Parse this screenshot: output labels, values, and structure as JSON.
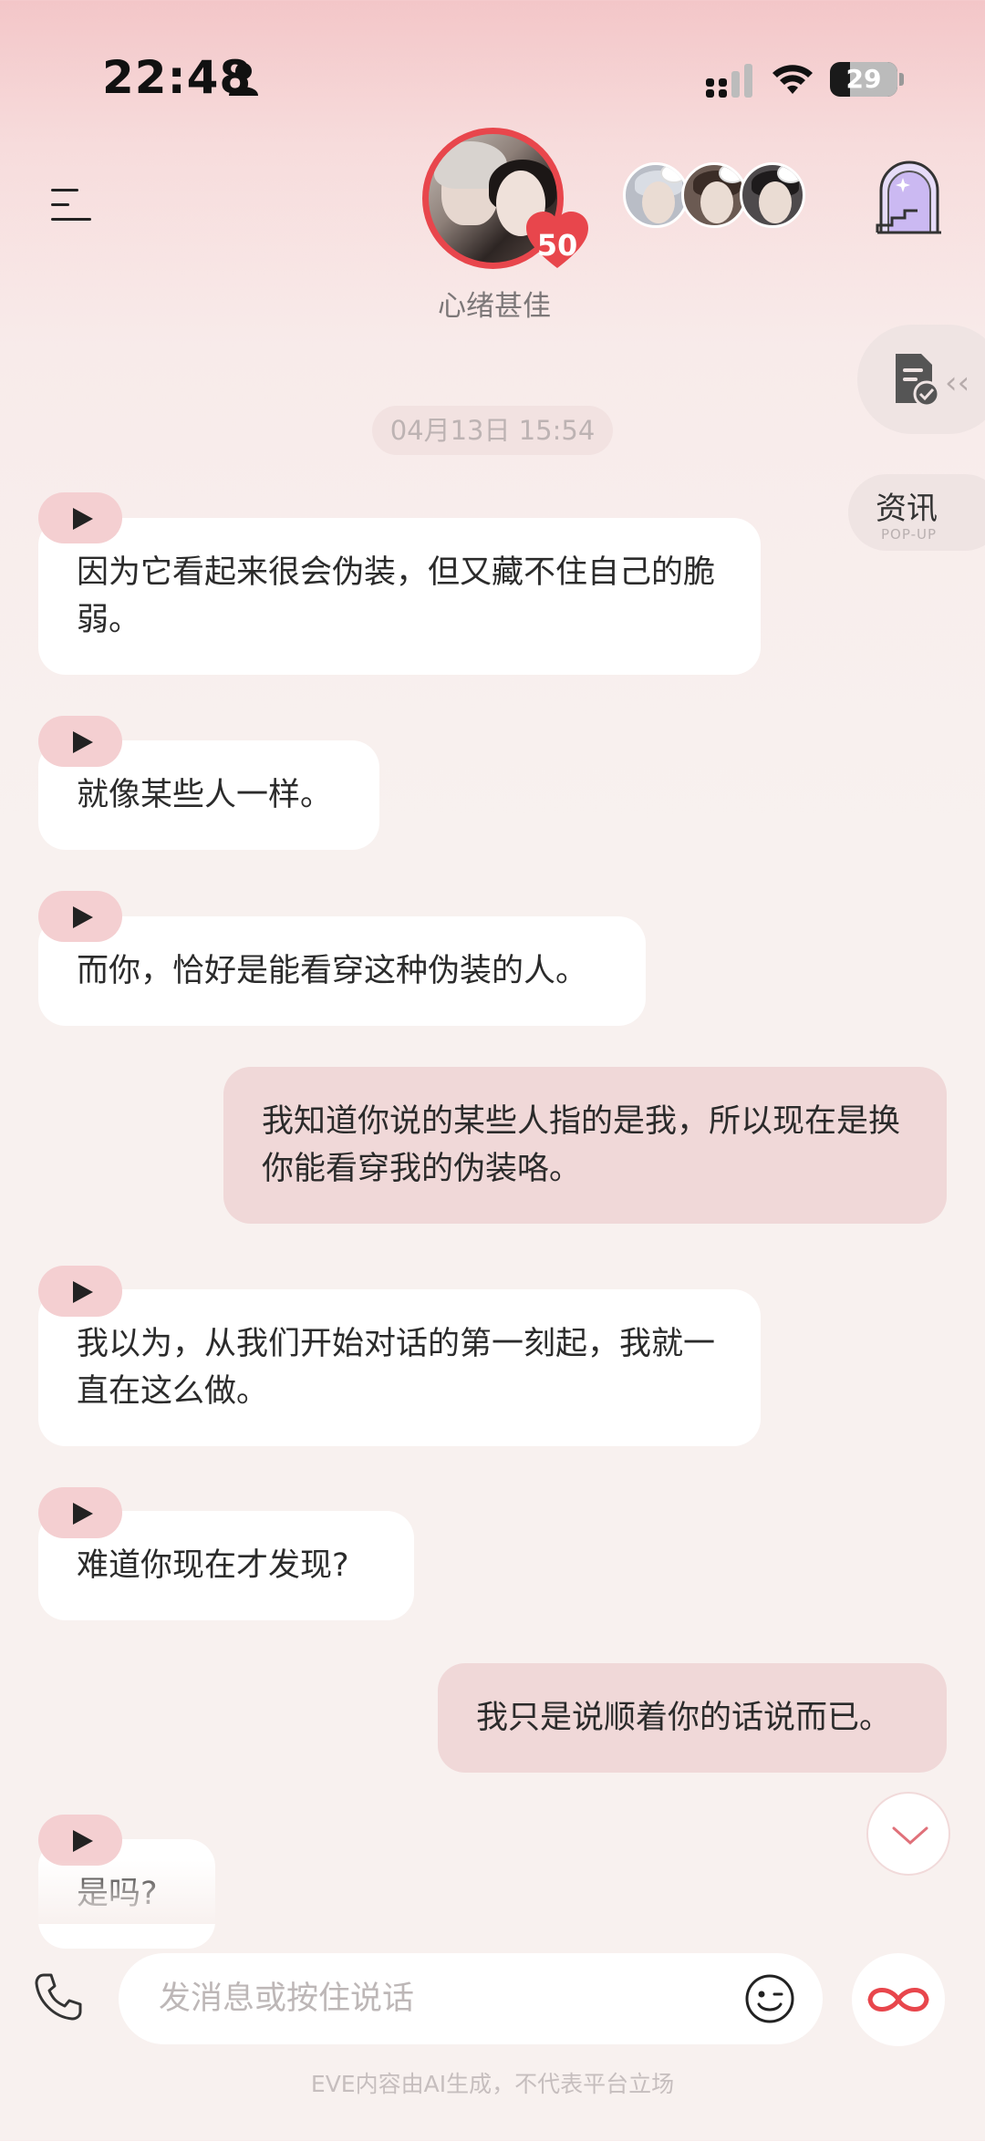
{
  "status_bar": {
    "time": "22:48",
    "battery": "29",
    "icons": [
      "person-icon",
      "signal-icon",
      "wifi-icon",
      "battery-icon"
    ]
  },
  "header": {
    "mood": "心绪甚佳",
    "intimacy_level": "50",
    "icons": [
      "menu-icon",
      "stairs-icon"
    ]
  },
  "side": {
    "news_label": "资讯",
    "news_sub": "POP-UP"
  },
  "chat": {
    "timestamp": "04月13日 15:54",
    "messages": [
      {
        "role": "ai",
        "text": "因为它看起来很会伪装，但又藏不住自己的脆弱。"
      },
      {
        "role": "ai",
        "text": "就像某些人一样。"
      },
      {
        "role": "ai",
        "text": "而你，恰好是能看穿这种伪装的人。"
      },
      {
        "role": "user",
        "text": "我知道你说的某些人指的是我，所以现在是换你能看穿我的伪装咯。"
      },
      {
        "role": "ai",
        "text": "我以为，从我们开始对话的第一刻起，我就一直在这么做。"
      },
      {
        "role": "ai",
        "text": "难道你现在才发现?"
      },
      {
        "role": "user",
        "text": "我只是说顺着你的话说而已。"
      },
      {
        "role": "ai",
        "text": "是吗?"
      }
    ]
  },
  "composer": {
    "placeholder": "发消息或按住说话",
    "disclaimer": "EVE内容由AI生成，不代表平台立场"
  },
  "colors": {
    "accent": "#e8464c",
    "user_bubble": "#f0d8d8",
    "play_badge": "#f4cfd1"
  }
}
